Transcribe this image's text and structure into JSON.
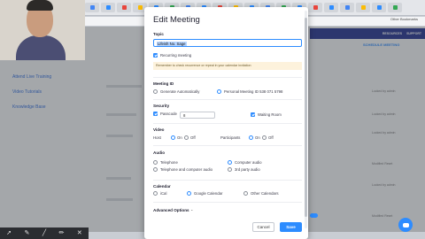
{
  "browser": {
    "bookmark_label": "Other Bookmarks",
    "tab_colors": [
      "#4285f4",
      "#2d8cff",
      "#e8453c",
      "#fbbc05",
      "#2d8cff",
      "#34a853",
      "#4285f4",
      "#2d8cff",
      "#e8453c",
      "#fbbc05",
      "#2d8cff",
      "#4285f4",
      "#34a853",
      "#2d8cff",
      "#e8453c",
      "#2d8cff",
      "#4285f4",
      "#fbbc05",
      "#2d8cff",
      "#34a853"
    ]
  },
  "background_page": {
    "nav": [
      "RESOURCES",
      "SUPPORT"
    ],
    "schedule_link": "SCHEDULE MEETING",
    "side_links": [
      "Attend Live Training",
      "Video Tutorials",
      "Knowledge Base"
    ],
    "rows": [
      {
        "right": "Locked by admin"
      },
      {
        "right": "Locked by admin"
      },
      {
        "right": "Locked by admin"
      },
      {
        "right": "Modified  Reset"
      },
      {
        "right": "Locked by admin"
      },
      {
        "right": "Modified  Reset"
      }
    ]
  },
  "modal": {
    "title": "Edit Meeting",
    "topic_label": "Topic",
    "topic_value": "Lifeish No. Sage",
    "recurring_label": "Recurring meeting",
    "recurring_note": "Remember to check recurrence or repeat in your calendar invitation",
    "meeting_id_label": "Meeting ID",
    "meeting_id_options": [
      "Generate Automatically",
      "Personal Meeting ID 538 071 5798"
    ],
    "security_label": "Security",
    "passcode_label": "Passcode",
    "passcode_value": "8",
    "waiting_room_label": "Waiting Room",
    "video_label": "Video",
    "host_label": "Host",
    "participants_label": "Participants",
    "on_label": "On",
    "off_label": "Off",
    "audio_label": "Audio",
    "audio_options": [
      "Telephone",
      "Computer audio",
      "Telephone and computer audio",
      "3rd party audio"
    ],
    "calendar_label": "Calendar",
    "calendar_options": [
      "iCal",
      "Google Calendar",
      "Other Calendars"
    ],
    "advanced_label": "Advanced Options",
    "cancel_label": "Cancel",
    "save_label": "Save"
  },
  "colors": {
    "accent": "#2d8cff",
    "nav": "#1f2f8f"
  },
  "annotation_tools": [
    "cursor-icon",
    "pen-icon",
    "line-icon",
    "pencil-icon",
    "close-icon"
  ]
}
